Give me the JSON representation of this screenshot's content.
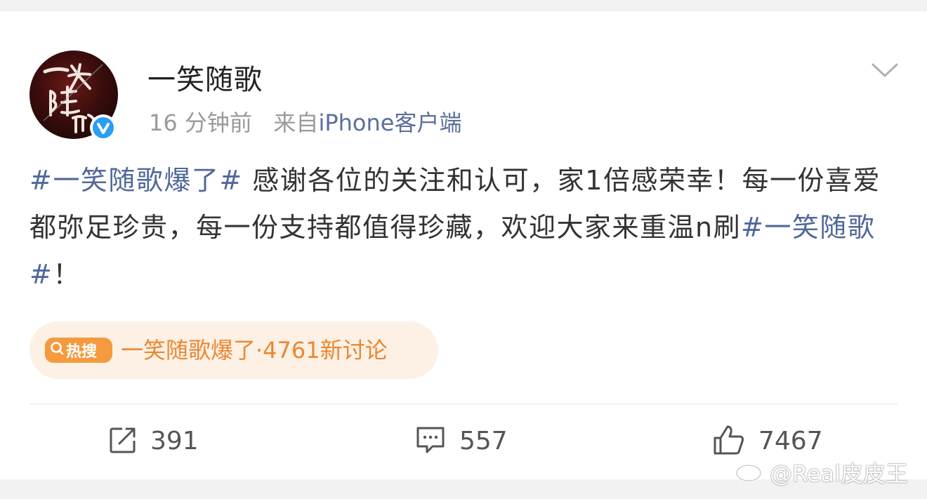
{
  "post": {
    "username": "一笑随歌",
    "time": "16 分钟前",
    "source_prefix": "来自",
    "source": "iPhone客户端",
    "content": {
      "topic1": "#一笑随歌爆了#",
      "text1": " 感谢各位的关注和认可，家1倍感荣幸！每一份喜爱都弥足珍贵，每一份支持都值得珍藏，欢迎大家来重温n刷",
      "topic2": "#一笑随歌#",
      "text2": "！"
    }
  },
  "hot_search": {
    "tag": "热搜",
    "text": "一笑随歌爆了·4761新讨论"
  },
  "actions": {
    "repost_count": "391",
    "comment_count": "557",
    "like_count": "7467"
  },
  "watermark": "@Real皮皮王",
  "colors": {
    "topic": "#50689a",
    "hot_tag": "#f49a3f",
    "hot_text": "#ec8630",
    "verified": "#2a9df4"
  },
  "icons": [
    "verified-icon",
    "chevron-down-icon",
    "search-icon",
    "repost-icon",
    "comment-icon",
    "like-icon",
    "weibo-icon"
  ]
}
